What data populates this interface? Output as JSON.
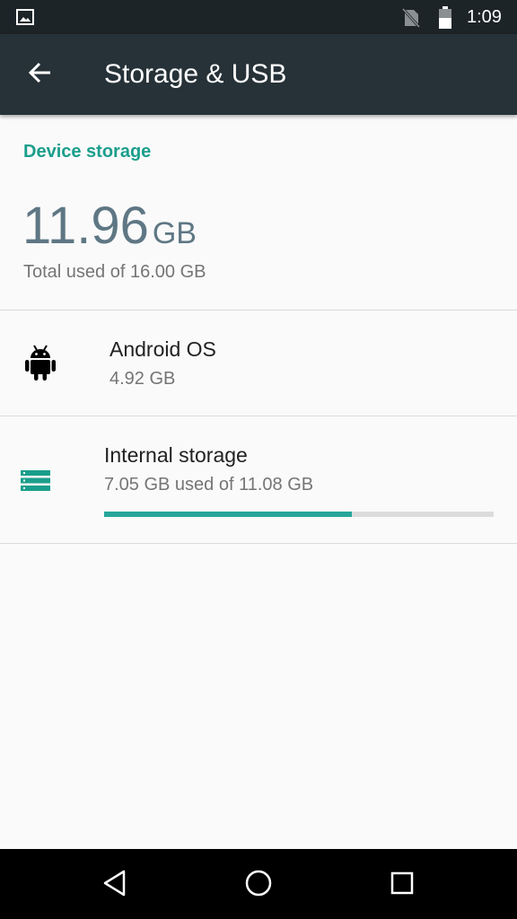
{
  "status_bar": {
    "time": "1:09",
    "icons": [
      "image-icon",
      "no-sim-icon",
      "battery-icon"
    ]
  },
  "app_bar": {
    "title": "Storage & USB",
    "back_icon": "arrow-back-icon"
  },
  "device_storage": {
    "header": "Device storage",
    "used_value": "11.96",
    "used_unit": "GB",
    "subtitle": "Total used of 16.00 GB"
  },
  "items": [
    {
      "icon": "android-icon",
      "title": "Android OS",
      "subtitle": "4.92 GB"
    },
    {
      "icon": "storage-icon",
      "title": "Internal storage",
      "subtitle": "7.05 GB used of 11.08 GB",
      "progress_fraction": 0.636
    }
  ],
  "colors": {
    "accent": "#1a9e8c",
    "progress": "#26a69a",
    "app_bar": "#263238",
    "status_bar": "#1c2428"
  },
  "nav_bar": {
    "buttons": [
      "back-triangle-icon",
      "home-circle-icon",
      "recents-square-icon"
    ]
  }
}
